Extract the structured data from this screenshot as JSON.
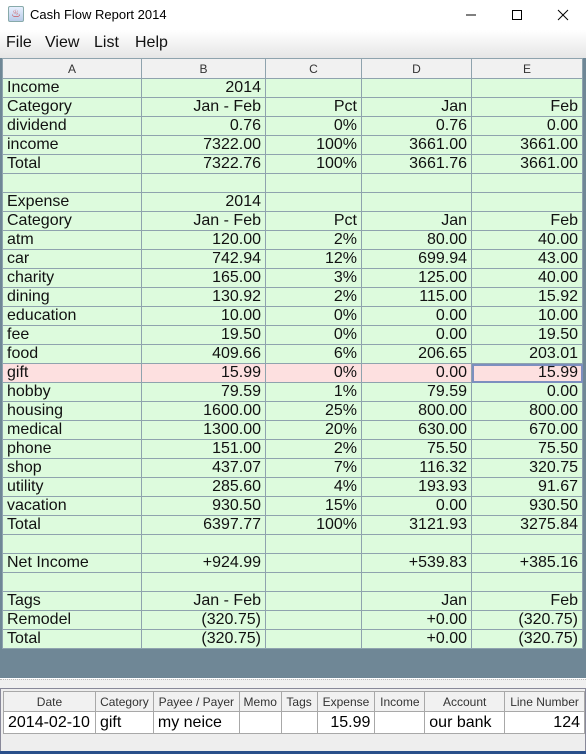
{
  "window": {
    "title": "Cash Flow Report 2014",
    "icon": "java-cup-icon",
    "controls": {
      "minimize": "—",
      "maximize": "☐",
      "close": "✕"
    }
  },
  "menubar": {
    "items": [
      "File",
      "View",
      "List",
      "Help"
    ]
  },
  "grid": {
    "columns": [
      "A",
      "B",
      "C",
      "D",
      "E"
    ],
    "rows": [
      [
        "Income",
        "2014",
        "",
        "",
        ""
      ],
      [
        "Category",
        "Jan - Feb",
        "Pct",
        "Jan",
        "Feb"
      ],
      [
        "dividend",
        "0.76",
        "0%",
        "0.76",
        "0.00"
      ],
      [
        "income",
        "7322.00",
        "100%",
        "3661.00",
        "3661.00"
      ],
      [
        "Total",
        "7322.76",
        "100%",
        "3661.76",
        "3661.00"
      ],
      [
        "",
        "",
        "",
        "",
        ""
      ],
      [
        "Expense",
        "2014",
        "",
        "",
        ""
      ],
      [
        "Category",
        "Jan - Feb",
        "Pct",
        "Jan",
        "Feb"
      ],
      [
        "atm",
        "120.00",
        "2%",
        "80.00",
        "40.00"
      ],
      [
        "car",
        "742.94",
        "12%",
        "699.94",
        "43.00"
      ],
      [
        "charity",
        "165.00",
        "3%",
        "125.00",
        "40.00"
      ],
      [
        "dining",
        "130.92",
        "2%",
        "115.00",
        "15.92"
      ],
      [
        "education",
        "10.00",
        "0%",
        "0.00",
        "10.00"
      ],
      [
        "fee",
        "19.50",
        "0%",
        "0.00",
        "19.50"
      ],
      [
        "food",
        "409.66",
        "6%",
        "206.65",
        "203.01"
      ],
      [
        "gift",
        "15.99",
        "0%",
        "0.00",
        "15.99"
      ],
      [
        "hobby",
        "79.59",
        "1%",
        "79.59",
        "0.00"
      ],
      [
        "housing",
        "1600.00",
        "25%",
        "800.00",
        "800.00"
      ],
      [
        "medical",
        "1300.00",
        "20%",
        "630.00",
        "670.00"
      ],
      [
        "phone",
        "151.00",
        "2%",
        "75.50",
        "75.50"
      ],
      [
        "shop",
        "437.07",
        "7%",
        "116.32",
        "320.75"
      ],
      [
        "utility",
        "285.60",
        "4%",
        "193.93",
        "91.67"
      ],
      [
        "vacation",
        "930.50",
        "15%",
        "0.00",
        "930.50"
      ],
      [
        "Total",
        "6397.77",
        "100%",
        "3121.93",
        "3275.84"
      ],
      [
        "",
        "",
        "",
        "",
        ""
      ],
      [
        "Net Income",
        "+924.99",
        "",
        "+539.83",
        "+385.16"
      ],
      [
        "",
        "",
        "",
        "",
        ""
      ],
      [
        "Tags",
        "Jan - Feb",
        "",
        "Jan",
        "Feb"
      ],
      [
        "Remodel",
        "(320.75)",
        "",
        "+0.00",
        "(320.75)"
      ],
      [
        "Total",
        "(320.75)",
        "",
        "+0.00",
        "(320.75)"
      ]
    ],
    "selected_row": 15,
    "focused_column": 4
  },
  "detail": {
    "columns": [
      "Date",
      "Category",
      "Payee / Payer",
      "Memo",
      "Tags",
      "Expense",
      "Income",
      "Account",
      "Line Number"
    ],
    "rows": [
      [
        "2014-02-10",
        "gift",
        "my neice",
        "",
        "",
        "15.99",
        "",
        "our bank",
        "124"
      ]
    ]
  }
}
